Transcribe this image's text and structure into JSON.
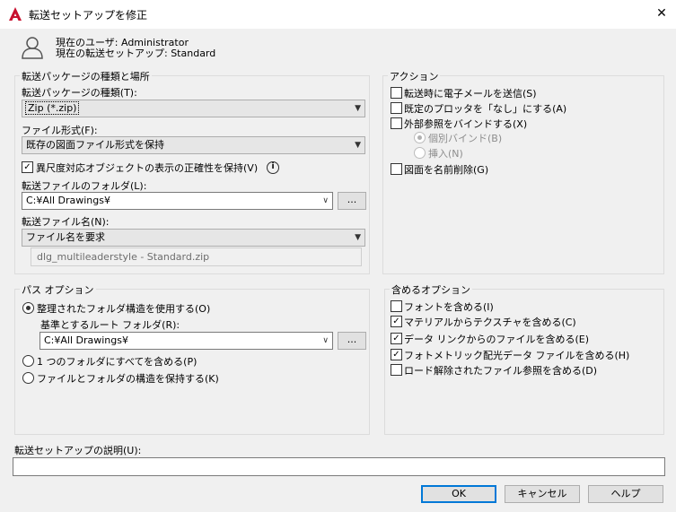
{
  "window": {
    "title": "転送セットアップを修正",
    "close_symbol": "✕"
  },
  "user_info": {
    "current_user": "現在のユーザ: Administrator",
    "current_setup": "現在の転送セットアップ: Standard"
  },
  "package": {
    "group_title": "転送パッケージの種類と場所",
    "type_label": "転送パッケージの種類(T):",
    "type_value": "Zip (*.zip)",
    "format_label": "ファイル形式(F):",
    "format_value": "既存の図面ファイル形式を保持",
    "fidelity_label": "異尺度対応オブジェクトの表示の正確性を保持(V)",
    "fidelity_checked": true,
    "folder_label": "転送ファイルのフォルダ(L):",
    "folder_value": "C:¥All Drawings¥",
    "browse_label": "...",
    "name_label": "転送ファイル名(N):",
    "name_value": "ファイル名を要求",
    "name_preview": "dlg_multileaderstyle - Standard.zip"
  },
  "actions": {
    "group_title": "アクション",
    "items": [
      {
        "label": "転送時に電子メールを送信(S)",
        "checked": false
      },
      {
        "label": "既定のプロッタを「なし」にする(A)",
        "checked": false
      },
      {
        "label": "外部参照をバインドする(X)",
        "checked": false
      },
      {
        "label": "図面を名前削除(G)",
        "checked": false
      }
    ],
    "bind_radio_label": "個別バインド(B)",
    "insert_radio_label": "挿入(N)"
  },
  "path_options": {
    "group_title": "パス オプション",
    "organized_label": "整理されたフォルダ構造を使用する(O)",
    "root_label": "基準とするルート フォルダ(R):",
    "root_value": "C:¥All Drawings¥",
    "browse_label": "...",
    "single_folder_label": "1 つのフォルダにすべてを含める(P)",
    "keep_structure_label": "ファイルとフォルダの構造を保持する(K)"
  },
  "include_options": {
    "group_title": "含めるオプション",
    "items": [
      {
        "label": "フォントを含める(I)",
        "checked": false
      },
      {
        "label": "マテリアルからテクスチャを含める(C)",
        "checked": true
      },
      {
        "label": "データ リンクからのファイルを含める(E)",
        "checked": true
      },
      {
        "label": "フォトメトリック配光データ ファイルを含める(H)",
        "checked": true
      },
      {
        "label": "ロード解除されたファイル参照を含める(D)",
        "checked": false
      }
    ]
  },
  "description": {
    "label": "転送セットアップの説明(U):",
    "value": ""
  },
  "buttons": {
    "ok": "OK",
    "cancel": "キャンセル",
    "help": "ヘルプ"
  },
  "colors": {
    "accent": "#0078d7",
    "app_icon": "#c8102e"
  }
}
